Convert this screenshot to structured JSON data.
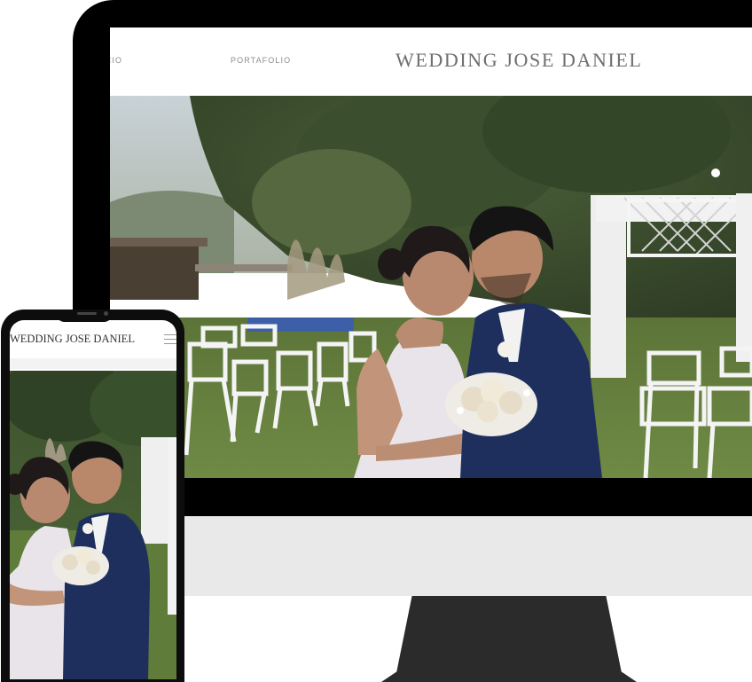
{
  "desktop": {
    "nav": {
      "inicio_label": "INICIO",
      "portafolio_label": "PORTAFOLIO"
    },
    "site_title": "WEDDING JOSE DANIEL"
  },
  "mobile": {
    "site_title": "WEDDING JOSE DANIEL",
    "menu_icon": "hamburger-menu-icon"
  },
  "colors": {
    "bezel": "#000000",
    "chin": "#e9e9e9",
    "stand": "#2b2b2b",
    "title_text": "#6e6e6e",
    "nav_text": "#8c8c8c",
    "suit_navy": "#1e2f5e",
    "grass": "#5f7a3a"
  }
}
